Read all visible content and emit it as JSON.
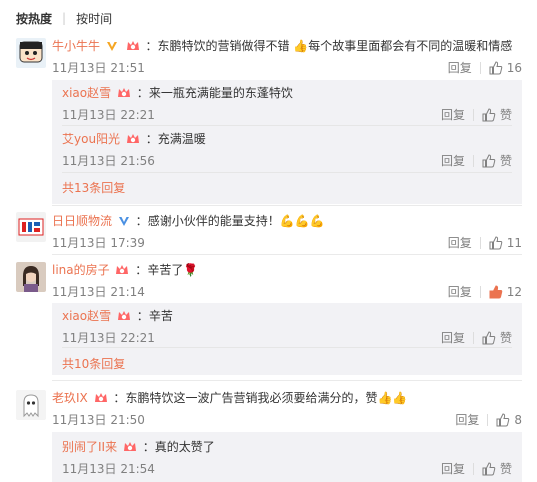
{
  "sort": {
    "hot": "按热度",
    "time": "按时间"
  },
  "comments": [
    {
      "user": "牛小牛牛",
      "text": "东鹏特饮的营销做得不错 👍每个故事里面都会有不同的温暖和情感",
      "time": "11月13日 21:51",
      "reply": "回复",
      "likes": "16",
      "replies": [
        {
          "user": "xiao赵雪",
          "text": "来一瓶充满能量的东蓬特饮",
          "time": "11月13日 22:21",
          "reply": "回复",
          "likes": "赞"
        },
        {
          "user": "艾you阳光",
          "text": "充满温暖",
          "time": "11月13日 21:56",
          "reply": "回复",
          "likes": "赞"
        }
      ],
      "more": "共13条回复"
    },
    {
      "user": "日日顺物流",
      "text": "感谢小伙伴的能量支持！💪💪💪",
      "time": "11月13日 17:39",
      "reply": "回复",
      "likes": "11"
    },
    {
      "user": "lina的房子",
      "text": "辛苦了🌹",
      "time": "11月13日 21:14",
      "reply": "回复",
      "likes": "12",
      "replies": [
        {
          "user": "xiao赵雪",
          "text": "辛苦",
          "time": "11月13日 22:21",
          "reply": "回复",
          "likes": "赞"
        }
      ],
      "more": "共10条回复"
    },
    {
      "user": "老玖IX",
      "text": "东鹏特饮这一波广告营销我必须要给满分的，赞👍👍",
      "time": "11月13日 21:50",
      "reply": "回复",
      "likes": "8",
      "replies": [
        {
          "user": "别闹了II来",
          "text": "真的太赞了",
          "time": "11月13日 21:54",
          "reply": "回复",
          "likes": "赞"
        }
      ]
    }
  ],
  "colors": {
    "username": "#eb7350",
    "meta": "#808080",
    "subbox": "#f2f2f5",
    "liked": "#eb7350"
  }
}
